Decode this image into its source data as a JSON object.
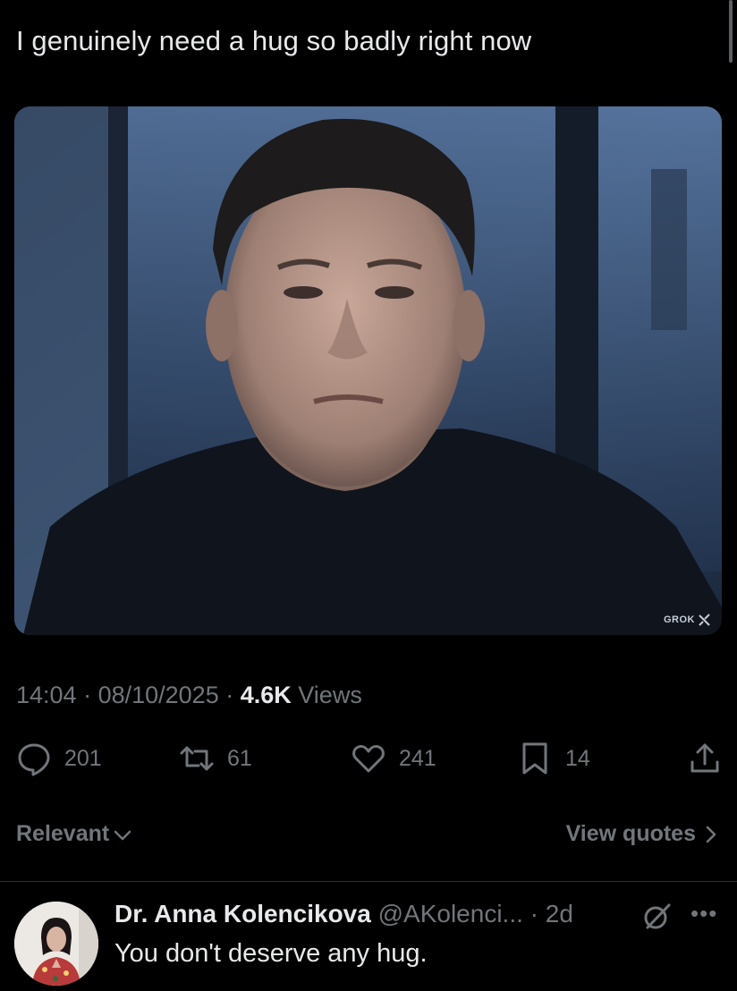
{
  "tweet": {
    "text": "I genuinely need a hug so badly right now",
    "image_watermark": "GROK",
    "time": "14:04",
    "date": "08/10/2025",
    "views_count": "4.6K",
    "views_label": "Views"
  },
  "actions": {
    "replies": "201",
    "reposts": "61",
    "likes": "241",
    "bookmarks": "14"
  },
  "sort": {
    "relevant_label": "Relevant",
    "view_quotes_label": "View quotes"
  },
  "reply": {
    "name": "Dr. Anna Kolencikova",
    "handle": "@AKolenci...",
    "age": "2d",
    "text": "You don't deserve any hug."
  },
  "colors": {
    "background": "#000000",
    "text": "#e7e9ea",
    "muted": "#71767b",
    "divider": "#2f3336"
  },
  "icons": [
    "reply-icon",
    "repost-icon",
    "like-icon",
    "bookmark-icon",
    "share-icon",
    "chevron-down-icon",
    "chevron-right-icon",
    "grok-icon",
    "more-icon"
  ]
}
